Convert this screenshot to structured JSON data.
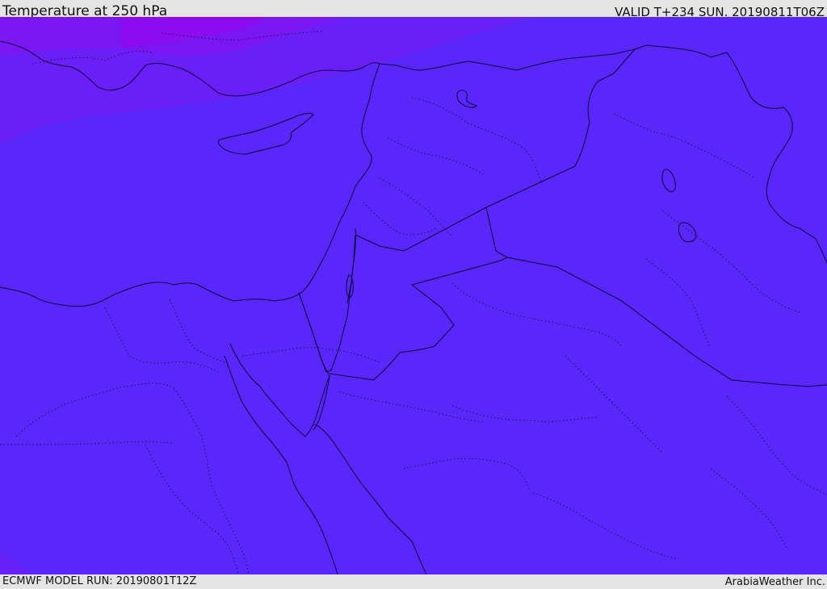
{
  "header": {
    "title": "Temperature at 250 hPa",
    "valid": "VALID T+234 SUN. 20190811T06Z"
  },
  "footer": {
    "model_run": "ECMWF MODEL RUN: 20190801T12Z",
    "credit": "ArabiaWeather Inc."
  },
  "colors": {
    "field_main": "#5a27fb",
    "field_warm_band": "#6a1ff7",
    "field_warmer_band": "#7a16f2",
    "field_hot_band": "#8a0cef",
    "border_line": "#0c0640",
    "frame": "#e4e4e4"
  }
}
